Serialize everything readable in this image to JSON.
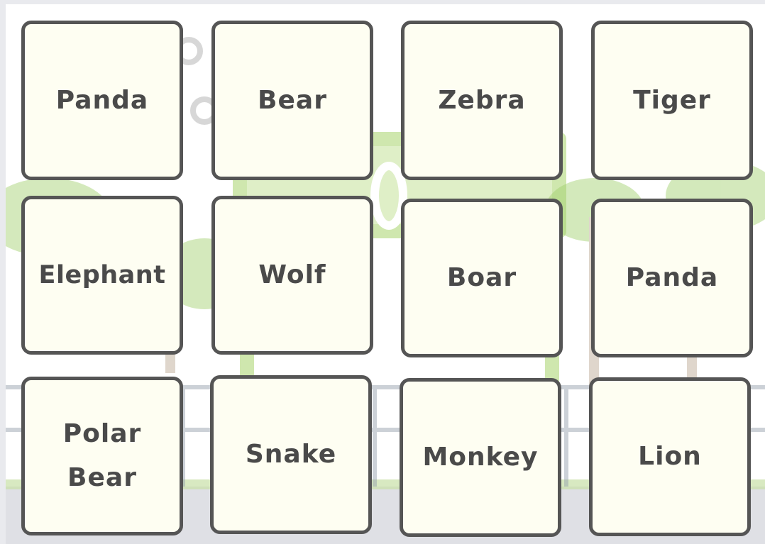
{
  "colors": {
    "card_fill": "#fefef2",
    "card_border": "#555555",
    "label_text": "#4a4a4a",
    "scene_tree": "#b9d98a",
    "scene_sign": "#9ccf5f",
    "scene_ground": "#c9cbd2"
  },
  "background": {
    "scene": "zoo entrance with trees, sign and fence",
    "sign_text": "ZOO"
  },
  "cards": [
    {
      "label": "Panda"
    },
    {
      "label": "Bear"
    },
    {
      "label": "Zebra"
    },
    {
      "label": "Tiger"
    },
    {
      "label": "Elephant"
    },
    {
      "label": "Wolf"
    },
    {
      "label": "Boar"
    },
    {
      "label": "Panda"
    },
    {
      "label": "Polar Bear"
    },
    {
      "label": "Snake"
    },
    {
      "label": "Monkey"
    },
    {
      "label": "Lion"
    }
  ]
}
